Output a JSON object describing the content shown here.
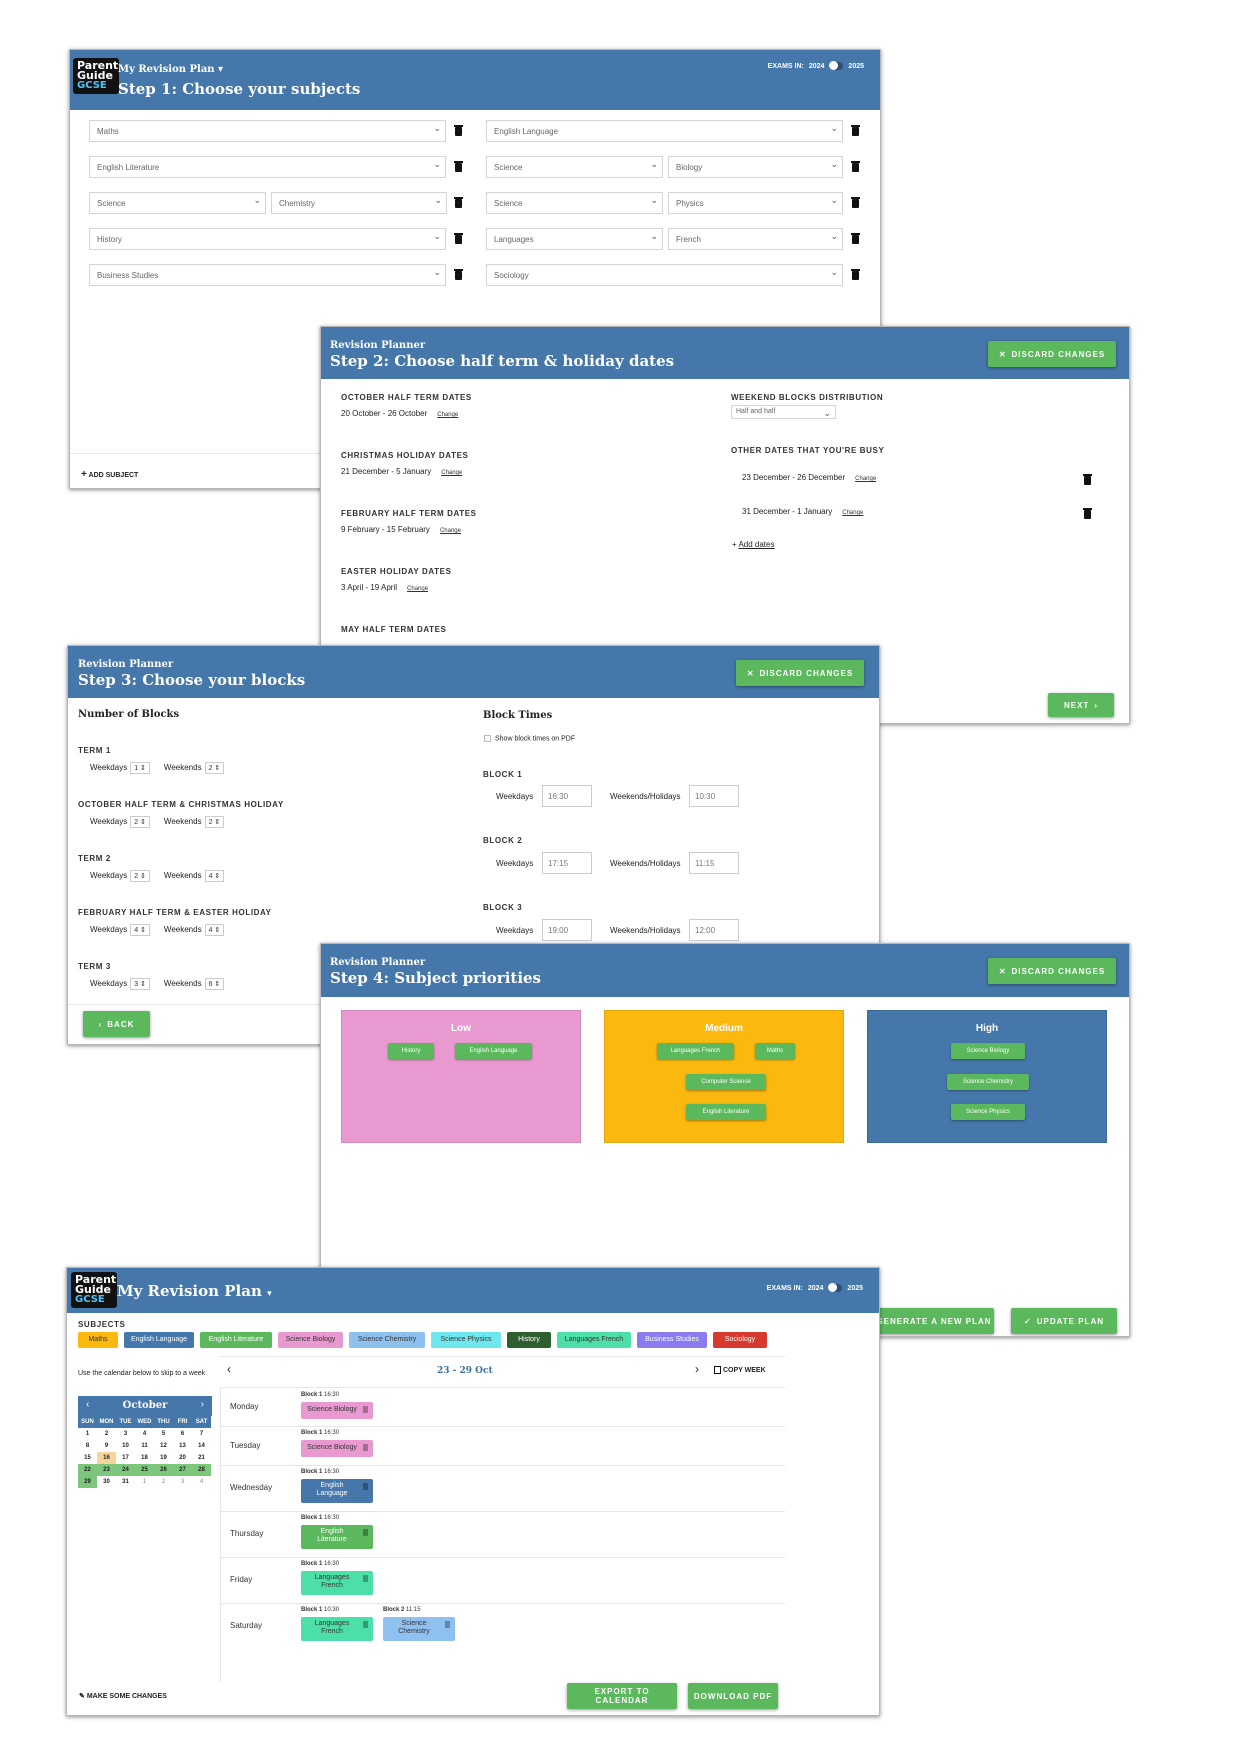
{
  "logo": {
    "line1": "Parent",
    "line2": "Guide",
    "line3": "GCSE"
  },
  "step1": {
    "menu_title": "My Revision Plan",
    "title": "Step 1: Choose your subjects",
    "exams_label": "EXAMS IN:",
    "year_a": "2024",
    "year_b": "2025",
    "rows_left": [
      [
        "Maths"
      ],
      [
        "English Literature"
      ],
      [
        "Science",
        "Chemistry"
      ],
      [
        "History"
      ],
      [
        "Business Studies"
      ]
    ],
    "rows_right": [
      [
        "English Language"
      ],
      [
        "Science",
        "Biology"
      ],
      [
        "Science",
        "Physics"
      ],
      [
        "Languages",
        "French"
      ],
      [
        "Sociology"
      ]
    ],
    "add_subject": "ADD SUBJECT"
  },
  "step2": {
    "kicker": "Revision Planner",
    "title": "Step 2: Choose half term & holiday dates",
    "discard": "DISCARD CHANGES",
    "change": "Change",
    "dates": [
      {
        "label": "OCTOBER HALF TERM DATES",
        "value": "20 October - 26 October"
      },
      {
        "label": "CHRISTMAS HOLIDAY DATES",
        "value": "21 December - 5 January"
      },
      {
        "label": "FEBRUARY HALF TERM DATES",
        "value": "9 February - 15 February"
      },
      {
        "label": "EASTER HOLIDAY DATES",
        "value": "3 April - 19 April"
      },
      {
        "label": "MAY HALF TERM DATES",
        "value": ""
      }
    ],
    "weekend_label": "WEEKEND BLOCKS DISTRIBUTION",
    "weekend_value": "Half and half",
    "busy_label": "OTHER DATES THAT YOU'RE BUSY",
    "busy": [
      "23 December - 26 December",
      "31 December - 1 January"
    ],
    "add_dates": "Add dates",
    "next": "NEXT"
  },
  "step3": {
    "kicker": "Revision Planner",
    "title": "Step 3: Choose your blocks",
    "discard": "DISCARD CHANGES",
    "num_blocks": "Number of Blocks",
    "weekdays": "Weekdays",
    "weekends": "Weekends",
    "terms": [
      {
        "label": "TERM 1",
        "wd": "1",
        "we": "2"
      },
      {
        "label": "OCTOBER HALF TERM & CHRISTMAS HOLIDAY",
        "wd": "2",
        "we": "2"
      },
      {
        "label": "TERM 2",
        "wd": "2",
        "we": "4"
      },
      {
        "label": "FEBRUARY HALF TERM & EASTER HOLIDAY",
        "wd": "4",
        "we": "4"
      },
      {
        "label": "TERM 3",
        "wd": "3",
        "we": "6"
      }
    ],
    "block_times": "Block Times",
    "show_pdf": "Show block times on PDF",
    "weekends_holidays": "Weekends/Holidays",
    "blocks": [
      {
        "label": "BLOCK 1",
        "wd": "16:30",
        "we": "10:30"
      },
      {
        "label": "BLOCK 2",
        "wd": "17:15",
        "we": "11:15"
      },
      {
        "label": "BLOCK 3",
        "wd": "19:00",
        "we": "12:00"
      }
    ],
    "back": "BACK"
  },
  "step4": {
    "kicker": "Revision Planner",
    "title": "Step 4: Subject priorities",
    "discard": "DISCARD CHANGES",
    "low": {
      "title": "Low",
      "chips": [
        "History",
        "English Language"
      ],
      "color": "#e89ad0"
    },
    "medium": {
      "title": "Medium",
      "chips": [
        "Languages French",
        "Maths",
        "Computer Science",
        "English Literature"
      ],
      "color": "#fbb80f"
    },
    "high": {
      "title": "High",
      "chips": [
        "Science Biology",
        "Science Chemistry",
        "Science Physics"
      ],
      "color": "#4577aa"
    },
    "generate": "GENERATE A NEW PLAN",
    "update": "UPDATE PLAN"
  },
  "plan": {
    "title": "My Revision Plan",
    "exams_label": "EXAMS IN:",
    "year_a": "2024",
    "year_b": "2025",
    "subjects_label": "SUBJECTS",
    "subjects": [
      {
        "name": "Maths",
        "color": "#fbb80f",
        "text": "#333"
      },
      {
        "name": "English Language",
        "color": "#4577aa",
        "text": "#fff"
      },
      {
        "name": "English Literature",
        "color": "#5cb85c",
        "text": "#fff"
      },
      {
        "name": "Science Biology",
        "color": "#e89ad0",
        "text": "#333"
      },
      {
        "name": "Science Chemistry",
        "color": "#8ec1f0",
        "text": "#333"
      },
      {
        "name": "Science Physics",
        "color": "#6ee8ee",
        "text": "#333"
      },
      {
        "name": "History",
        "color": "#2e5e2e",
        "text": "#fff"
      },
      {
        "name": "Languages French",
        "color": "#4ce0a8",
        "text": "#333"
      },
      {
        "name": "Business Studies",
        "color": "#8a7cf0",
        "text": "#fff"
      },
      {
        "name": "Sociology",
        "color": "#d63a2f",
        "text": "#fff"
      }
    ],
    "calendar_hint": "Use the calendar below to skip to a week",
    "month": "October",
    "dow": [
      "SUN",
      "MON",
      "TUE",
      "WED",
      "THU",
      "FRI",
      "SAT"
    ],
    "weeks": [
      [
        "1",
        "2",
        "3",
        "4",
        "5",
        "6",
        "7"
      ],
      [
        "8",
        "9",
        "10",
        "11",
        "12",
        "13",
        "14"
      ],
      [
        "15",
        "16",
        "17",
        "18",
        "19",
        "20",
        "21"
      ],
      [
        "22",
        "23",
        "24",
        "25",
        "26",
        "27",
        "28"
      ],
      [
        "29",
        "30",
        "31",
        "1",
        "2",
        "3",
        "4"
      ]
    ],
    "today": "16",
    "week_range": "23 - 29 Oct",
    "copy_week": "COPY WEEK",
    "days": [
      {
        "name": "Monday",
        "events": [
          {
            "block": "Block 1",
            "time": "16:30",
            "subject": "Science Biology",
            "color": "#e89ad0",
            "text": "#333"
          }
        ]
      },
      {
        "name": "Tuesday",
        "events": [
          {
            "block": "Block 1",
            "time": "16:30",
            "subject": "Science Biology",
            "color": "#e89ad0",
            "text": "#333"
          }
        ]
      },
      {
        "name": "Wednesday",
        "events": [
          {
            "block": "Block 1",
            "time": "16:30",
            "subject": "English Language",
            "color": "#4577aa",
            "text": "#fff"
          }
        ]
      },
      {
        "name": "Thursday",
        "events": [
          {
            "block": "Block 1",
            "time": "16:30",
            "subject": "English Literature",
            "color": "#5cb85c",
            "text": "#fff"
          }
        ]
      },
      {
        "name": "Friday",
        "events": [
          {
            "block": "Block 1",
            "time": "16:30",
            "subject": "Languages French",
            "color": "#4ce0a8",
            "text": "#333"
          }
        ]
      },
      {
        "name": "Saturday",
        "events": [
          {
            "block": "Block 1",
            "time": "10:30",
            "subject": "Languages French",
            "color": "#4ce0a8",
            "text": "#333"
          },
          {
            "block": "Block 2",
            "time": "11:15",
            "subject": "Science Chemistry",
            "color": "#8ec1f0",
            "text": "#333"
          }
        ]
      }
    ],
    "make_changes": "MAKE SOME CHANGES",
    "export": "EXPORT TO CALENDAR",
    "download": "DOWNLOAD PDF"
  }
}
